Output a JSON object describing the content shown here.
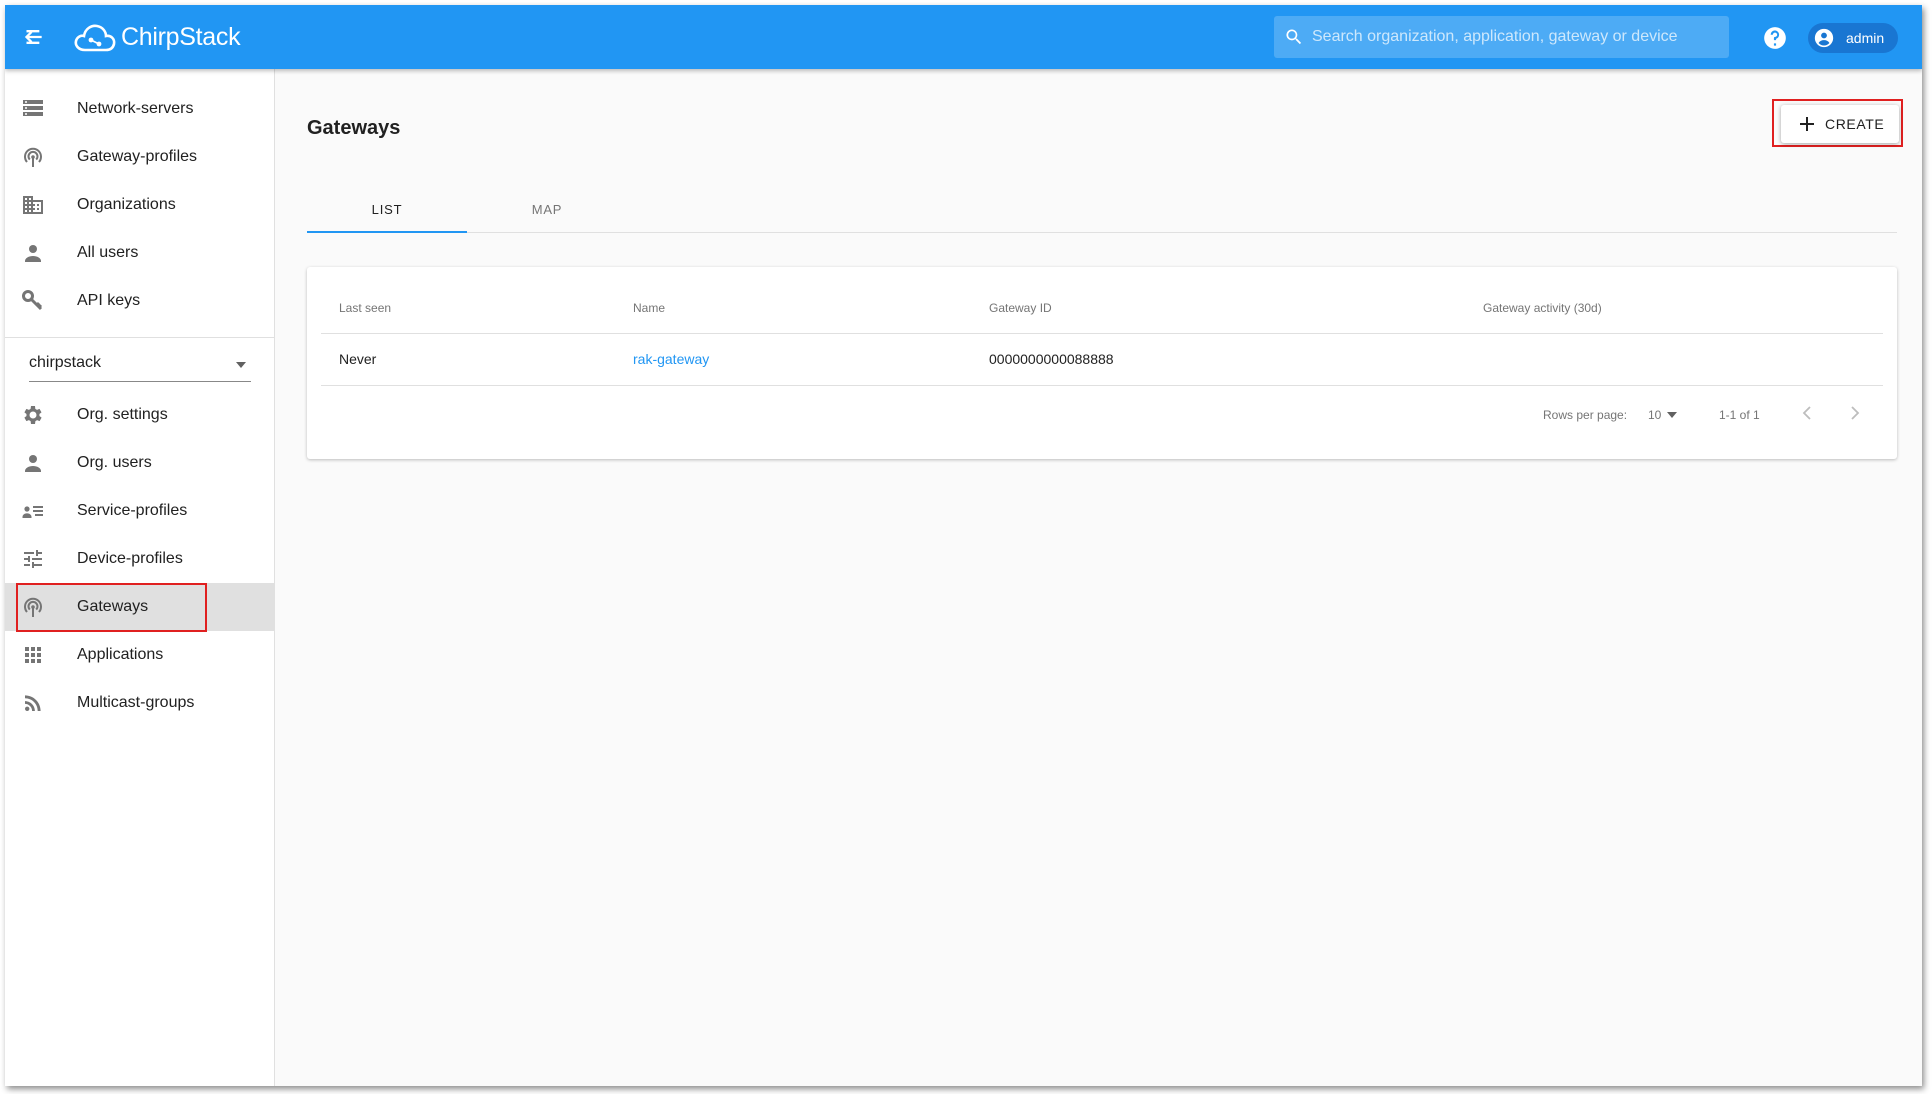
{
  "app": {
    "name": "ChirpStack"
  },
  "header": {
    "search_placeholder": "Search organization, application, gateway or device",
    "user": "admin"
  },
  "sidebar": {
    "admin_items": [
      {
        "label": "Network-servers",
        "icon": "network-servers-icon"
      },
      {
        "label": "Gateway-profiles",
        "icon": "gateway-profiles-icon"
      },
      {
        "label": "Organizations",
        "icon": "organizations-icon"
      },
      {
        "label": "All users",
        "icon": "all-users-icon"
      },
      {
        "label": "API keys",
        "icon": "api-keys-icon"
      }
    ],
    "org_selector": {
      "value": "chirpstack"
    },
    "org_items": [
      {
        "label": "Org. settings",
        "icon": "gear-icon"
      },
      {
        "label": "Org. users",
        "icon": "org-users-icon"
      },
      {
        "label": "Service-profiles",
        "icon": "service-profiles-icon"
      },
      {
        "label": "Device-profiles",
        "icon": "device-profiles-icon"
      },
      {
        "label": "Gateways",
        "icon": "gateways-icon",
        "active": true
      },
      {
        "label": "Applications",
        "icon": "applications-icon"
      },
      {
        "label": "Multicast-groups",
        "icon": "multicast-groups-icon"
      }
    ]
  },
  "main": {
    "title": "Gateways",
    "create_label": "CREATE",
    "tabs": [
      {
        "label": "LIST",
        "active": true
      },
      {
        "label": "MAP",
        "active": false
      }
    ],
    "table": {
      "columns": [
        "Last seen",
        "Name",
        "Gateway ID",
        "Gateway activity (30d)"
      ],
      "rows": [
        {
          "last_seen": "Never",
          "name": "rak-gateway",
          "gateway_id": "0000000000088888",
          "activity": ""
        }
      ],
      "pagination": {
        "rows_per_page_label": "Rows per page:",
        "rows_per_page": "10",
        "range": "1-1 of 1"
      }
    }
  },
  "colors": {
    "primary": "#2196f3",
    "highlight": "#e02020"
  }
}
